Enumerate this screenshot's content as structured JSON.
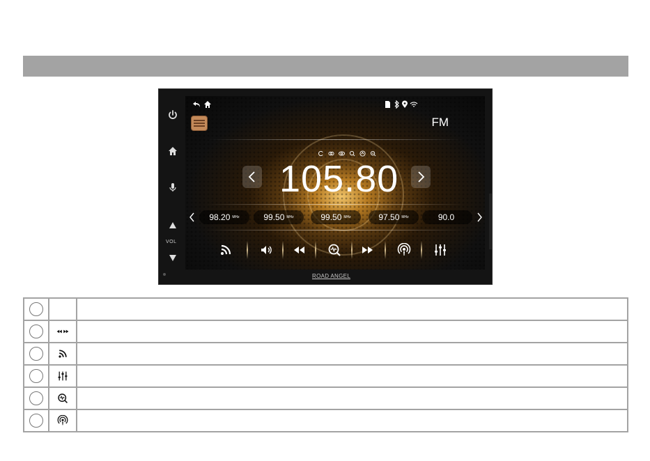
{
  "device": {
    "frequency": "105.80",
    "band_label": "FM",
    "vol_label": "VOL",
    "brand": "ROAD ANGEL",
    "presets": [
      {
        "freq": "98.20",
        "unit": "MHz"
      },
      {
        "freq": "99.50",
        "unit": "MHz"
      },
      {
        "freq": "99.50",
        "unit": "MHz"
      },
      {
        "freq": "97.50",
        "unit": "MHz"
      },
      {
        "freq": "90.0",
        "unit": ""
      }
    ]
  },
  "legend": {
    "rows": [
      {
        "icon": "blank"
      },
      {
        "icon": "prev-next-icon"
      },
      {
        "icon": "rds-icon"
      },
      {
        "icon": "equalizer-icon"
      },
      {
        "icon": "scan-icon"
      },
      {
        "icon": "podcast-icon"
      }
    ]
  },
  "colors": {
    "header_bar": "#a3a3a3",
    "border": "#a3a3a3",
    "accent_glow": "#f0c46a"
  }
}
